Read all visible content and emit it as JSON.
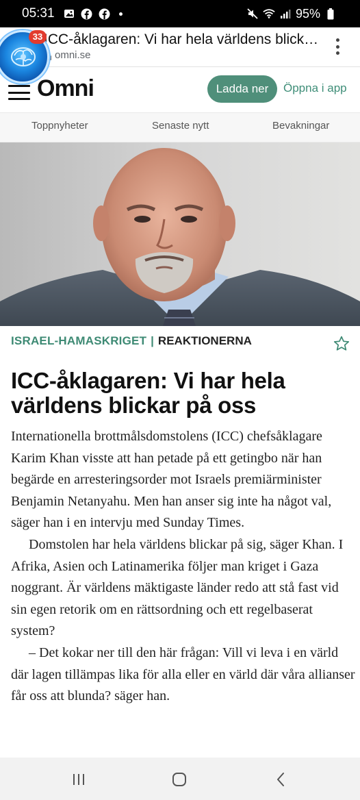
{
  "status_bar": {
    "time": "05:31",
    "battery": "95%",
    "icons": [
      "gallery-icon",
      "facebook-icon",
      "facebook-icon",
      "dot-icon",
      "mute-icon",
      "wifi-icon",
      "signal-icon",
      "battery-icon"
    ]
  },
  "browser": {
    "notification_count": "33",
    "page_title": "ICC-åklagaren: Vi har hela världens blick…",
    "domain": "omni.se"
  },
  "header": {
    "logo": "Omni",
    "download_label": "Ladda ner",
    "open_app_label": "Öppna i app",
    "accent_color": "#4f8f7a"
  },
  "subnav": {
    "items": [
      {
        "label": "Toppnyheter"
      },
      {
        "label": "Senaste nytt"
      },
      {
        "label": "Bevakningar"
      }
    ]
  },
  "article": {
    "category": "ISRAEL-HAMASKRIGET",
    "separator": "|",
    "subcategory": "REAKTIONERNA",
    "headline": "ICC-åklagaren: Vi har hela världens blickar på oss",
    "paragraphs": [
      "Internationella brottmålsdomstolens (ICC) chefsåklagare Karim Khan visste att han petade på ett getingbo när han begärde en arresteringsorder mot Israels premiärminister Benjamin Netanyahu. Men han anser sig inte ha något val, säger han i en intervju med Sunday Times.",
      "Domstolen har hela världens blickar på sig, säger Khan. I Afrika, Asien och Latinamerika följer man kriget i Gaza noggrant. Är världens mäktigaste länder redo att stå fast vid sin egen retorik om en rättsordning och ett regelbaserat system?",
      "– Det kokar ner till den här frågan: Vill vi leva i en värld där lagen tillämpas lika för alla eller en värld där våra allianser får oss att blunda? säger han."
    ]
  }
}
